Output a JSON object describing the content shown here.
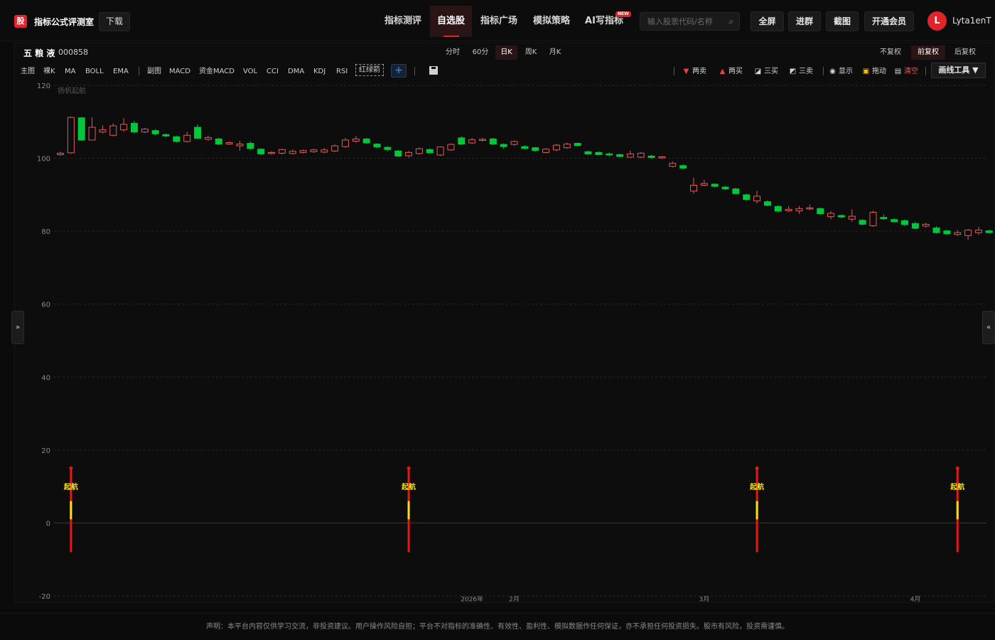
{
  "header": {
    "logo_glyph": "股",
    "app_title": "指标公式评测室",
    "download_label": "下载",
    "nav": [
      {
        "label": "指标测评",
        "active": false
      },
      {
        "label": "自选股",
        "active": true
      },
      {
        "label": "指标广场",
        "active": false
      },
      {
        "label": "模拟策略",
        "active": false
      },
      {
        "label": "AI写指标",
        "active": false
      }
    ],
    "new_badge": "NEW",
    "search_placeholder": "输入股票代码/名称",
    "search_icon": "search-icon",
    "buttons": {
      "fullscreen": "全屏",
      "join_group": "进群",
      "screenshot": "截图",
      "vip": "开通会员"
    },
    "avatar_letter": "L",
    "username": "Lyta1enT",
    "accent_color": "#e0242a"
  },
  "stock": {
    "name": "五 粮 液",
    "code": "000858"
  },
  "periods": [
    {
      "label": "分时",
      "active": false
    },
    {
      "label": "60分",
      "active": false
    },
    {
      "label": "日K",
      "active": true
    },
    {
      "label": "周K",
      "active": false
    },
    {
      "label": "月K",
      "active": false
    }
  ],
  "adjust": [
    {
      "label": "不复权",
      "active": false
    },
    {
      "label": "前复权",
      "active": true
    },
    {
      "label": "后复权",
      "active": false
    }
  ],
  "indicators": {
    "main_label": "主图",
    "main": [
      "裸K",
      "MA",
      "BOLL",
      "EMA"
    ],
    "sub_label": "副图",
    "sub": [
      "MACD",
      "资金MACD",
      "VOL",
      "CCI",
      "DMA",
      "KDJ",
      "RSI"
    ],
    "custom": "红绿箭",
    "add": "+"
  },
  "right_tools": [
    {
      "label": "两卖",
      "icon": "down-triangle-icon",
      "glyph": "▼",
      "color": "#ff3b30"
    },
    {
      "label": "两买",
      "icon": "up-triangle-icon",
      "glyph": "▲",
      "color": "#ff3b30"
    },
    {
      "label": "三买",
      "icon": "trend-up-icon",
      "glyph": "◪",
      "color": "#d0d0d0"
    },
    {
      "label": "三卖",
      "icon": "trend-down-icon",
      "glyph": "◩",
      "color": "#d0d0d0"
    },
    {
      "label": "显示",
      "icon": "eye-icon",
      "glyph": "◉",
      "color": "#d0d0d0"
    },
    {
      "label": "拖动",
      "icon": "lock-icon",
      "glyph": "▣",
      "color": "#f0c020"
    },
    {
      "label": "清空",
      "icon": "trash-icon",
      "glyph": "▤",
      "color": "#d0d0d0"
    }
  ],
  "draw_tools_label": "画线工具 ▼",
  "side_left": "»",
  "side_right": "«",
  "footer": "声明：本平台内容仅供学习交流，非投资建议。用户操作风险自担；平台不对指标的准确性、有效性、盈利性、模拟数据作任何保证，亦不承担任何投资损失。股市有风险，投资需谨慎。",
  "chart_data": {
    "type": "candlestick",
    "ylim": [
      -20,
      120
    ],
    "yticks": [
      120,
      100,
      80,
      60,
      40,
      20,
      0,
      -20
    ],
    "title": "",
    "annotation": "扬帆起航",
    "x_labels": [
      {
        "index": 39,
        "label": "2026年"
      },
      {
        "index": 43,
        "label": "2月"
      },
      {
        "index": 61,
        "label": "3月"
      },
      {
        "index": 81,
        "label": "4月"
      }
    ],
    "signal_label": "起航",
    "signal_indices": [
      1,
      33,
      66,
      85
    ],
    "signal_range": [
      -8,
      15
    ],
    "colors": {
      "up": "#e05a5a",
      "down": "#00c83a",
      "grid": "#262626",
      "signal": "#e01a1a",
      "signal_mid": "#f5e020",
      "tick": "#8a8a8a"
    },
    "candles": [
      {
        "o": 101.0,
        "c": 101.4,
        "h": 101.8,
        "l": 100.6
      },
      {
        "o": 101.5,
        "c": 111.2,
        "h": 111.4,
        "l": 101.2
      },
      {
        "o": 111.1,
        "c": 105.0,
        "h": 111.3,
        "l": 104.8
      },
      {
        "o": 105.0,
        "c": 108.5,
        "h": 111.2,
        "l": 104.9
      },
      {
        "o": 107.2,
        "c": 107.8,
        "h": 109.0,
        "l": 106.8
      },
      {
        "o": 106.3,
        "c": 108.9,
        "h": 109.6,
        "l": 106.0
      },
      {
        "o": 107.8,
        "c": 109.3,
        "h": 111.0,
        "l": 107.3
      },
      {
        "o": 109.6,
        "c": 107.2,
        "h": 110.2,
        "l": 106.8
      },
      {
        "o": 107.2,
        "c": 108.0,
        "h": 108.3,
        "l": 106.9
      },
      {
        "o": 107.6,
        "c": 106.7,
        "h": 108.0,
        "l": 106.3
      },
      {
        "o": 106.5,
        "c": 106.1,
        "h": 106.8,
        "l": 105.8
      },
      {
        "o": 105.9,
        "c": 104.6,
        "h": 106.2,
        "l": 104.3
      },
      {
        "o": 104.6,
        "c": 106.3,
        "h": 107.3,
        "l": 104.3
      },
      {
        "o": 108.5,
        "c": 105.5,
        "h": 109.3,
        "l": 105.2
      },
      {
        "o": 105.2,
        "c": 105.7,
        "h": 106.2,
        "l": 104.8
      },
      {
        "o": 105.3,
        "c": 103.9,
        "h": 105.6,
        "l": 103.6
      },
      {
        "o": 103.9,
        "c": 104.3,
        "h": 104.6,
        "l": 103.7
      },
      {
        "o": 103.4,
        "c": 103.9,
        "h": 104.8,
        "l": 102.1
      },
      {
        "o": 104.1,
        "c": 102.7,
        "h": 104.6,
        "l": 102.3
      },
      {
        "o": 102.5,
        "c": 101.2,
        "h": 102.7,
        "l": 100.9
      },
      {
        "o": 101.3,
        "c": 101.6,
        "h": 101.9,
        "l": 101.0
      },
      {
        "o": 101.4,
        "c": 102.4,
        "h": 102.6,
        "l": 101.0
      },
      {
        "o": 101.3,
        "c": 101.9,
        "h": 102.4,
        "l": 101.0
      },
      {
        "o": 101.6,
        "c": 102.1,
        "h": 102.4,
        "l": 101.3
      },
      {
        "o": 101.8,
        "c": 102.3,
        "h": 102.6,
        "l": 101.5
      },
      {
        "o": 101.7,
        "c": 102.3,
        "h": 102.8,
        "l": 101.4
      },
      {
        "o": 102.0,
        "c": 103.4,
        "h": 103.8,
        "l": 101.7
      },
      {
        "o": 103.2,
        "c": 105.0,
        "h": 105.6,
        "l": 102.9
      },
      {
        "o": 104.7,
        "c": 105.3,
        "h": 106.1,
        "l": 104.3
      },
      {
        "o": 105.3,
        "c": 104.2,
        "h": 105.6,
        "l": 103.9
      },
      {
        "o": 103.9,
        "c": 103.1,
        "h": 104.1,
        "l": 102.8
      },
      {
        "o": 103.0,
        "c": 102.4,
        "h": 103.3,
        "l": 101.9
      },
      {
        "o": 102.0,
        "c": 100.6,
        "h": 102.3,
        "l": 100.3
      },
      {
        "o": 100.7,
        "c": 101.6,
        "h": 102.0,
        "l": 100.2
      },
      {
        "o": 101.3,
        "c": 102.6,
        "h": 103.0,
        "l": 101.0
      },
      {
        "o": 102.4,
        "c": 101.5,
        "h": 102.7,
        "l": 101.2
      },
      {
        "o": 100.9,
        "c": 103.1,
        "h": 103.3,
        "l": 100.6
      },
      {
        "o": 102.3,
        "c": 103.8,
        "h": 104.1,
        "l": 102.0
      },
      {
        "o": 105.6,
        "c": 103.9,
        "h": 106.1,
        "l": 103.6
      },
      {
        "o": 104.2,
        "c": 105.1,
        "h": 105.6,
        "l": 103.9
      },
      {
        "o": 104.9,
        "c": 105.2,
        "h": 105.6,
        "l": 104.6
      },
      {
        "o": 105.3,
        "c": 103.9,
        "h": 105.6,
        "l": 103.6
      },
      {
        "o": 103.8,
        "c": 103.2,
        "h": 104.1,
        "l": 102.6
      },
      {
        "o": 103.8,
        "c": 104.6,
        "h": 104.9,
        "l": 103.4
      },
      {
        "o": 103.2,
        "c": 102.7,
        "h": 103.6,
        "l": 102.4
      },
      {
        "o": 102.9,
        "c": 102.1,
        "h": 103.1,
        "l": 101.8
      },
      {
        "o": 101.6,
        "c": 102.5,
        "h": 102.8,
        "l": 101.3
      },
      {
        "o": 102.3,
        "c": 103.6,
        "h": 104.0,
        "l": 101.9
      },
      {
        "o": 102.9,
        "c": 103.9,
        "h": 104.3,
        "l": 102.6
      },
      {
        "o": 104.1,
        "c": 103.5,
        "h": 104.3,
        "l": 103.2
      },
      {
        "o": 101.8,
        "c": 101.2,
        "h": 102.1,
        "l": 101.0
      },
      {
        "o": 101.6,
        "c": 101.0,
        "h": 101.9,
        "l": 100.8
      },
      {
        "o": 101.2,
        "c": 100.9,
        "h": 101.6,
        "l": 100.6
      },
      {
        "o": 101.0,
        "c": 100.5,
        "h": 101.3,
        "l": 100.2
      },
      {
        "o": 100.3,
        "c": 101.2,
        "h": 102.1,
        "l": 100.1
      },
      {
        "o": 100.3,
        "c": 101.4,
        "h": 101.7,
        "l": 100.0
      },
      {
        "o": 100.6,
        "c": 100.2,
        "h": 100.9,
        "l": 99.9
      },
      {
        "o": 100.1,
        "c": 100.4,
        "h": 100.6,
        "l": 99.8
      },
      {
        "o": 97.8,
        "c": 98.6,
        "h": 99.1,
        "l": 97.5
      },
      {
        "o": 98.0,
        "c": 97.3,
        "h": 98.3,
        "l": 97.0
      },
      {
        "o": 91.0,
        "c": 92.6,
        "h": 94.7,
        "l": 90.3
      },
      {
        "o": 92.6,
        "c": 93.1,
        "h": 94.1,
        "l": 92.3
      },
      {
        "o": 92.9,
        "c": 92.3,
        "h": 93.1,
        "l": 92.0
      },
      {
        "o": 92.1,
        "c": 91.6,
        "h": 92.4,
        "l": 91.3
      },
      {
        "o": 91.6,
        "c": 90.3,
        "h": 91.9,
        "l": 90.1
      },
      {
        "o": 90.0,
        "c": 88.7,
        "h": 90.3,
        "l": 88.3
      },
      {
        "o": 88.3,
        "c": 89.6,
        "h": 91.1,
        "l": 87.6
      },
      {
        "o": 88.1,
        "c": 87.1,
        "h": 88.5,
        "l": 86.9
      },
      {
        "o": 86.8,
        "c": 85.5,
        "h": 87.1,
        "l": 85.2
      },
      {
        "o": 85.6,
        "c": 86.0,
        "h": 86.9,
        "l": 85.3
      },
      {
        "o": 85.6,
        "c": 86.2,
        "h": 86.9,
        "l": 84.8
      },
      {
        "o": 86.1,
        "c": 86.4,
        "h": 87.3,
        "l": 85.8
      },
      {
        "o": 86.2,
        "c": 84.8,
        "h": 86.5,
        "l": 84.5
      },
      {
        "o": 84.0,
        "c": 84.9,
        "h": 85.5,
        "l": 83.3
      },
      {
        "o": 84.3,
        "c": 83.9,
        "h": 84.6,
        "l": 83.5
      },
      {
        "o": 83.3,
        "c": 84.1,
        "h": 86.0,
        "l": 82.6
      },
      {
        "o": 83.0,
        "c": 81.9,
        "h": 83.3,
        "l": 81.6
      },
      {
        "o": 81.5,
        "c": 85.2,
        "h": 85.6,
        "l": 81.2
      },
      {
        "o": 83.8,
        "c": 83.4,
        "h": 84.6,
        "l": 83.1
      },
      {
        "o": 83.2,
        "c": 82.6,
        "h": 83.6,
        "l": 82.3
      },
      {
        "o": 82.9,
        "c": 81.8,
        "h": 83.2,
        "l": 81.4
      },
      {
        "o": 82.1,
        "c": 80.8,
        "h": 82.6,
        "l": 80.5
      },
      {
        "o": 81.4,
        "c": 81.9,
        "h": 82.3,
        "l": 81.0
      },
      {
        "o": 80.9,
        "c": 79.6,
        "h": 81.4,
        "l": 79.3
      },
      {
        "o": 80.1,
        "c": 79.3,
        "h": 80.4,
        "l": 79.0
      },
      {
        "o": 79.1,
        "c": 79.6,
        "h": 80.3,
        "l": 78.7
      },
      {
        "o": 78.8,
        "c": 80.3,
        "h": 80.6,
        "l": 77.6
      },
      {
        "o": 79.6,
        "c": 80.3,
        "h": 81.2,
        "l": 79.0
      },
      {
        "o": 80.1,
        "c": 79.6,
        "h": 80.4,
        "l": 79.3
      },
      {
        "o": 79.4,
        "c": 78.6,
        "h": 79.7,
        "l": 78.3
      }
    ]
  }
}
